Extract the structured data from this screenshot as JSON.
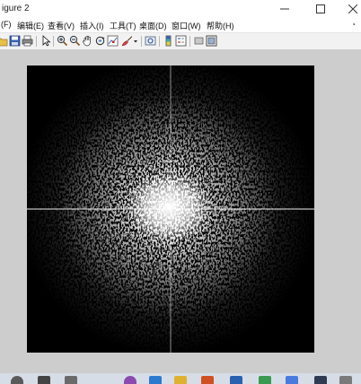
{
  "window": {
    "title": "igure 2"
  },
  "menubar": {
    "items": [
      {
        "label": "(F)"
      },
      {
        "label": "编辑(E)"
      },
      {
        "label": "查看(V)"
      },
      {
        "label": "插入(I)"
      },
      {
        "label": "工具(T)"
      },
      {
        "label": "桌面(D)"
      },
      {
        "label": "窗口(W)"
      },
      {
        "label": "帮助(H)"
      }
    ],
    "overflow_glyph": "◔"
  },
  "toolbar": {
    "icons": [
      "open-icon",
      "save-icon",
      "print-icon",
      "pointer-icon",
      "zoom-in-icon",
      "zoom-out-icon",
      "pan-icon",
      "rotate-icon",
      "data-cursor-icon",
      "brush-icon",
      "dropdown-arrow-icon",
      "link-plot-icon",
      "colorbar-icon",
      "legend-icon",
      "hide-plot-tools-icon",
      "show-plot-tools-icon"
    ]
  },
  "colors": {
    "plot_background": "#000000",
    "spectrum": "#ffffff",
    "figure_background": "#cdcdcd"
  }
}
